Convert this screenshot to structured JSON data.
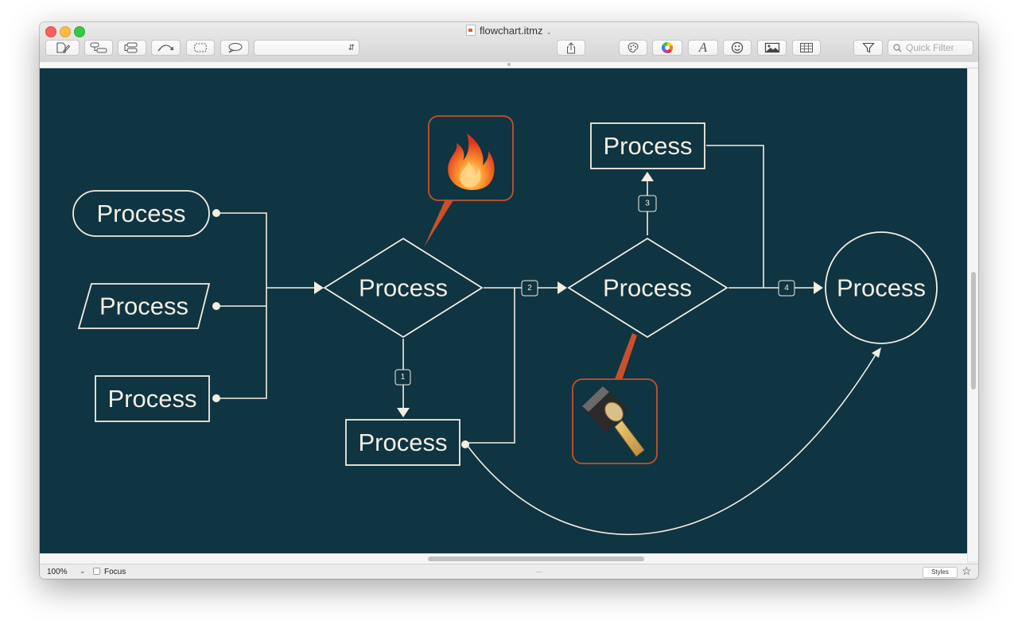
{
  "window": {
    "title": "flowchart.itmz"
  },
  "toolbar": {
    "buttons": [
      "new-topic",
      "new-child",
      "new-sibling",
      "relationship",
      "boundary",
      "callout"
    ],
    "popup_value": "",
    "right_buttons": [
      "share",
      "palette",
      "color-wheel",
      "font",
      "emoji",
      "image",
      "table",
      "filter"
    ],
    "search_placeholder": "Quick Filter"
  },
  "diagram": {
    "nodes": [
      {
        "id": "terminal",
        "shape": "stadium",
        "label": "Process"
      },
      {
        "id": "parallelogram",
        "shape": "parallelogram",
        "label": "Process"
      },
      {
        "id": "rect-left",
        "shape": "rectangle",
        "label": "Process"
      },
      {
        "id": "diamond-1",
        "shape": "diamond",
        "label": "Process"
      },
      {
        "id": "rect-bottom",
        "shape": "rectangle",
        "label": "Process"
      },
      {
        "id": "diamond-2",
        "shape": "diamond",
        "label": "Process"
      },
      {
        "id": "rect-top",
        "shape": "rectangle",
        "label": "Process"
      },
      {
        "id": "circle",
        "shape": "circle",
        "label": "Process"
      }
    ],
    "badges": [
      "1",
      "2",
      "3",
      "4"
    ],
    "callouts": [
      {
        "attached_to": "diamond-1",
        "icon": "fire-icon"
      },
      {
        "attached_to": "diamond-2",
        "icon": "hammer-icon"
      }
    ],
    "colors": {
      "background": "#0f3442",
      "line": "#f3eee2",
      "callout_border": "#c8502a"
    }
  },
  "statusbar": {
    "zoom": "100%",
    "focus_label": "Focus",
    "center_dots": "...",
    "styles_label": "Styles"
  }
}
